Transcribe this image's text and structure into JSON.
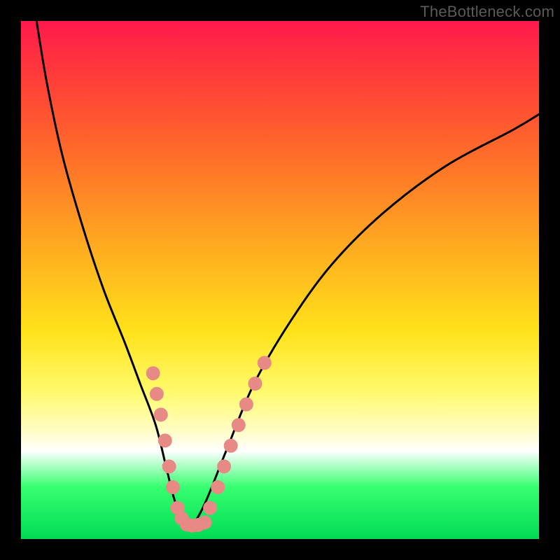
{
  "watermark": "TheBottleneck.com",
  "chart_data": {
    "type": "line",
    "title": "",
    "xlabel": "",
    "ylabel": "",
    "xlim": [
      0,
      100
    ],
    "ylim": [
      0,
      100
    ],
    "series": [
      {
        "name": "bottleneck-curve",
        "x": [
          3,
          5,
          8,
          12,
          16,
          20,
          23,
          26,
          28,
          29.5,
          31,
          32.5,
          34,
          36,
          40,
          45,
          52,
          60,
          70,
          82,
          95,
          100
        ],
        "values": [
          100,
          88,
          74,
          60,
          48,
          38,
          30,
          22,
          14,
          8,
          4,
          2.5,
          4,
          8,
          18,
          30,
          42,
          53,
          63,
          72,
          79,
          82
        ]
      }
    ],
    "markers": {
      "name": "highlighted-points",
      "color": "#e78a86",
      "points": [
        {
          "x": 25.5,
          "y": 32
        },
        {
          "x": 26.2,
          "y": 28
        },
        {
          "x": 27.0,
          "y": 24
        },
        {
          "x": 27.8,
          "y": 19
        },
        {
          "x": 28.6,
          "y": 14
        },
        {
          "x": 29.3,
          "y": 10
        },
        {
          "x": 30.2,
          "y": 6
        },
        {
          "x": 31.0,
          "y": 4
        },
        {
          "x": 32.0,
          "y": 2.8
        },
        {
          "x": 33.0,
          "y": 2.6
        },
        {
          "x": 34.2,
          "y": 2.7
        },
        {
          "x": 35.5,
          "y": 3.2
        },
        {
          "x": 36.5,
          "y": 6
        },
        {
          "x": 38.0,
          "y": 10
        },
        {
          "x": 39.2,
          "y": 14
        },
        {
          "x": 40.5,
          "y": 18
        },
        {
          "x": 42.0,
          "y": 22
        },
        {
          "x": 43.5,
          "y": 26
        },
        {
          "x": 45.2,
          "y": 30
        },
        {
          "x": 47.0,
          "y": 34
        }
      ]
    },
    "background_gradient": {
      "stops": [
        {
          "pos": 0,
          "color": "#ff1a4c"
        },
        {
          "pos": 60,
          "color": "#ffe21a"
        },
        {
          "pos": 83,
          "color": "#ffffff"
        },
        {
          "pos": 100,
          "color": "#00db55"
        }
      ]
    }
  }
}
